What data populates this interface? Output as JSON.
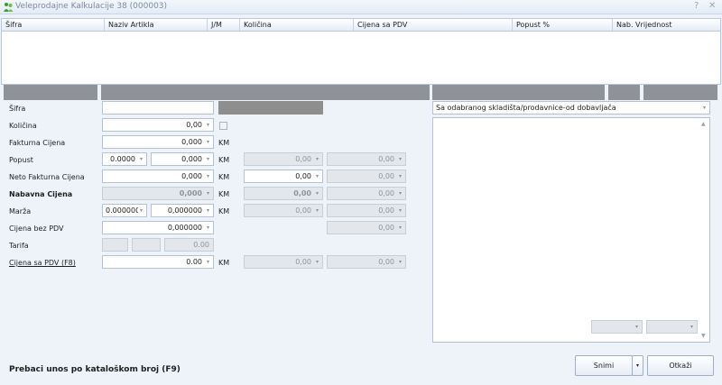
{
  "window": {
    "title": "Veleprodajne Kalkulacije 38 (000003)",
    "help_glyph": "?",
    "close_glyph": "✕",
    "app_icon": "green-people-icon"
  },
  "grid": {
    "columns": [
      "Šifra",
      "Naziv Artikla",
      "J/M",
      "Količina",
      "Cijena sa PDV",
      "Popust %",
      "Nab. Vrijednost"
    ]
  },
  "form": {
    "labels": {
      "sifra": "Šifra",
      "kolicina": "Količina",
      "fakturna": "Fakturna Cijena",
      "popust": "Popust",
      "neto": "Neto Fakturna Cijena",
      "nabavna": "Nabavna Cijena",
      "marza": "Marža",
      "bez_pdv": "Cijena bez PDV",
      "tarifa": "Tarifa",
      "sa_pdv": "Cijena sa PDV (F8)"
    },
    "unit": "KM",
    "values": {
      "kolicina": "0,00",
      "fakturna": "0,000",
      "popust_pct": "0.0000",
      "popust_amt": "0,000",
      "popust_c3": "0,00",
      "popust_c4": "0,00",
      "neto": "0,000",
      "neto_c3": "0,00",
      "neto_c4": "0,00",
      "nabavna": "0,000",
      "nabavna_c3": "0,00",
      "nabavna_c4": "0,00",
      "marza_pct": "0.000000",
      "marza_amt": "0,000000",
      "marza_c3": "0,00",
      "marza_c4": "0,00",
      "bez_pdv": "0,000000",
      "bez_pdv_c4": "0,00",
      "tarifa_val": "0.00",
      "sa_pdv": "0.00",
      "sa_pdv_c3": "0,00",
      "sa_pdv_c4": "0,00"
    },
    "dropdown_glyph": "▾"
  },
  "store": {
    "selected": "Sa odabranog skladišta/prodavnice-od dobavljača"
  },
  "footer": {
    "catalog_link": "Prebaci unos po kataloškom broj (F9)",
    "save_label": "Snimi",
    "cancel_label": "Otkaži"
  }
}
